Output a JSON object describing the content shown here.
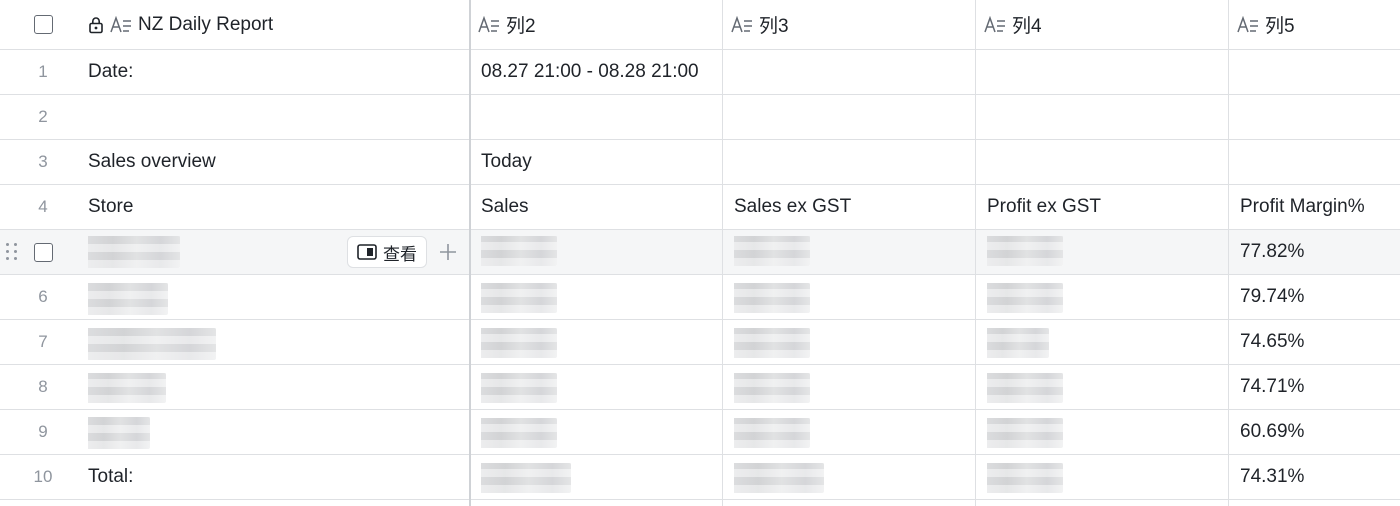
{
  "header": {
    "col1_label": "NZ Daily Report",
    "col2_label": "列2",
    "col3_label": "列3",
    "col4_label": "列4",
    "col5_label": "列5",
    "field_type_icon": "text-field-icon",
    "locked_icon": "lock-icon"
  },
  "rows": [
    {
      "num": "1",
      "c1": "Date:",
      "c2": "08.27 21:00 - 08.28 21:00",
      "c3": "",
      "c4": "",
      "c5": ""
    },
    {
      "num": "2",
      "c1": "",
      "c2": "",
      "c3": "",
      "c4": "",
      "c5": ""
    },
    {
      "num": "3",
      "c1": "Sales overview",
      "c2": "Today",
      "c3": "",
      "c4": "",
      "c5": ""
    },
    {
      "num": "4",
      "c1": "Store",
      "c2": "Sales",
      "c3": "Sales ex GST",
      "c4": "Profit ex GST",
      "c5": "Profit Margin%"
    },
    {
      "num": "",
      "c5": "77.82%"
    },
    {
      "num": "6",
      "c5": "79.74%"
    },
    {
      "num": "7",
      "c5": "74.65%"
    },
    {
      "num": "8",
      "c5": "74.71%"
    },
    {
      "num": "9",
      "c5": "60.69%"
    },
    {
      "num": "10",
      "c1": "Total:",
      "c5": "74.31%"
    }
  ],
  "hover_row": {
    "view_label": "查看",
    "view_icon": "sidebar-panel-icon",
    "add_icon": "plus-icon",
    "drag_icon": "drag-handle-icon"
  },
  "colors": {
    "border": "#dee0e3",
    "hover_bg": "#f5f6f7",
    "text": "#1f2329",
    "muted": "#8f959e"
  }
}
